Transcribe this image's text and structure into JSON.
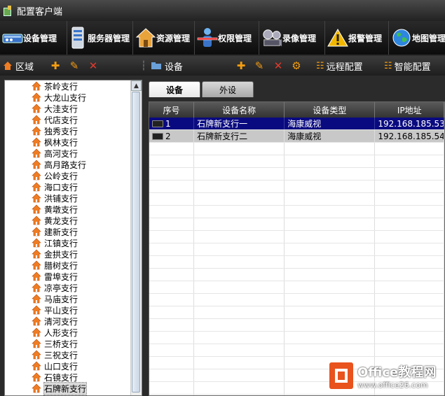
{
  "window": {
    "title": "配置客户端"
  },
  "toolbar": [
    {
      "label": "设备管理",
      "icon": "device-icon"
    },
    {
      "label": "服务器管理",
      "icon": "server-icon"
    },
    {
      "label": "资源管理",
      "icon": "house-icon"
    },
    {
      "label": "权限管理",
      "icon": "user-permission-icon"
    },
    {
      "label": "录像管理",
      "icon": "film-reel-icon"
    },
    {
      "label": "报警管理",
      "icon": "warning-icon"
    },
    {
      "label": "地图管理",
      "icon": "globe-icon"
    }
  ],
  "left_header": {
    "title": "区域"
  },
  "right_header": {
    "title": "设备",
    "remote_config": "远程配置",
    "smart_config": "智能配置"
  },
  "tree": {
    "items": [
      "茶岭支行",
      "大龙山支行",
      "大洼支行",
      "代店支行",
      "独秀支行",
      "枫林支行",
      "高河支行",
      "高月路支行",
      "公岭支行",
      "海口支行",
      "洪铺支行",
      "黄墩支行",
      "黄龙支行",
      "建新支行",
      "江镇支行",
      "金拱支行",
      "腊树支行",
      "雷埠支行",
      "凉亭支行",
      "马庙支行",
      "平山支行",
      "清河支行",
      "人形支行",
      "三桥支行",
      "三祝支行",
      "山口支行",
      "石镜支行",
      "石牌新支行"
    ],
    "selected": "石牌新支行"
  },
  "tabs": [
    "设备",
    "外设"
  ],
  "table": {
    "headers": [
      "序号",
      "设备名称",
      "设备类型",
      "IP地址"
    ],
    "rows": [
      {
        "no": "1",
        "name": "石牌新支行一",
        "type": "海康威视",
        "ip": "192.168.185.53"
      },
      {
        "no": "2",
        "name": "石牌新支行二",
        "type": "海康威视",
        "ip": "192.168.185.54"
      }
    ]
  },
  "watermark": {
    "brand": "Office教程网",
    "url": "www.office26.com"
  },
  "colors": {
    "selected_row": "#0a0a80",
    "toolbar_bg": "#111111",
    "accent_orange": "#f39c12"
  }
}
